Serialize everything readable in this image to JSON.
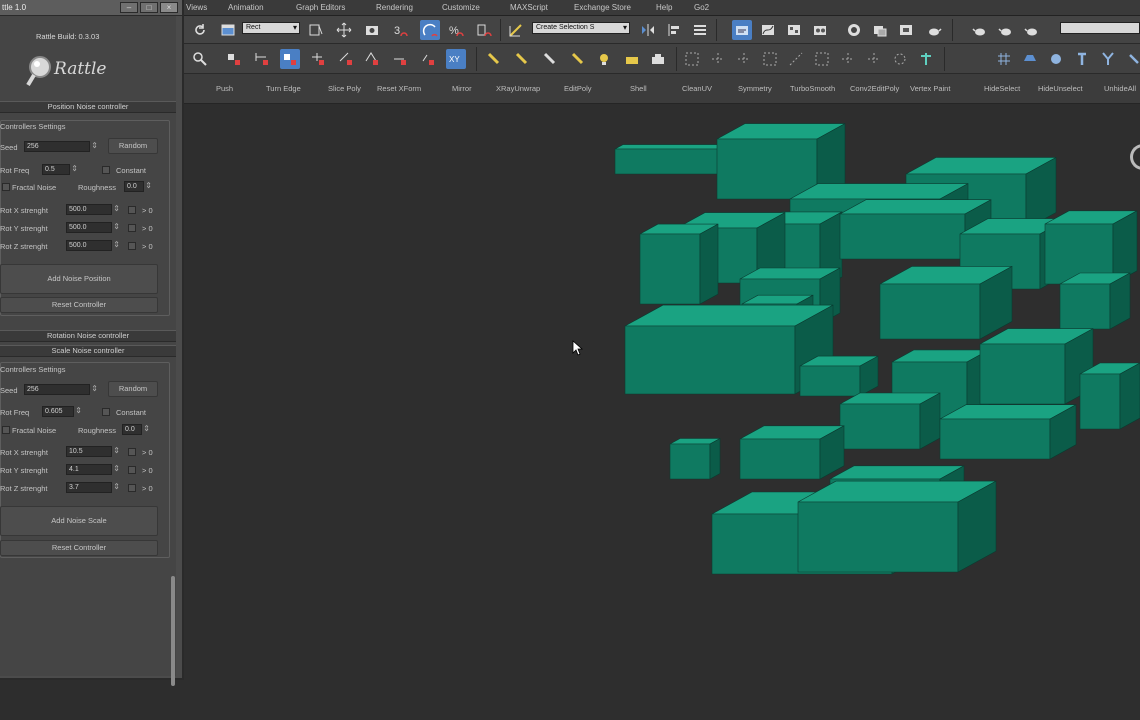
{
  "menubar": {
    "items": [
      "Views",
      "Animation",
      "Graph Editors",
      "Rendering",
      "Customize",
      "MAXScript",
      "Exchange Store",
      "Help",
      "Go2"
    ]
  },
  "toolbar": {
    "selection_filter": "Rect",
    "named_selection": "Create Selection S",
    "search_placeholder": ""
  },
  "command_row": {
    "buttons": [
      "Push",
      "Turn Edge",
      "Slice Poly",
      "Reset XForm",
      "Mirror",
      "XRayUnwrap",
      "EditPoly",
      "Shell",
      "CleanUV",
      "Symmetry",
      "TurboSmooth",
      "Conv2EditPoly",
      "Vertex Paint",
      "HideSelect",
      "HideUnselect",
      "UnhideAll"
    ]
  },
  "panel": {
    "window_title": "ttle 1.0",
    "build_label": "Rattle Build: 0.3.03",
    "logo_text": "Rattle",
    "position": {
      "header": "Position Noise controller",
      "group_title": "Controllers Settings",
      "seed_label": "Seed",
      "seed_value": "256",
      "random_label": "Random",
      "rot_freq_label": "Rot Freq",
      "rot_freq_value": "0.5",
      "constant_label": "Constant",
      "fractal_label": "Fractal Noise",
      "roughness_label": "Roughness",
      "roughness_value": "0.0",
      "x_label": "Rot X strenght",
      "x_value": "500.0",
      "y_label": "Rot Y strenght",
      "y_value": "500.0",
      "z_label": "Rot Z strenght",
      "z_value": "500.0",
      "gt0": "> 0",
      "add_button": "Add Noise Position",
      "reset_button": "Reset Controller"
    },
    "rotation_header": "Rotation Noise controller",
    "scale": {
      "header": "Scale Noise controller",
      "group_title": "Controllers Settings",
      "seed_label": "Seed",
      "seed_value": "256",
      "random_label": "Random",
      "rot_freq_label": "Rot Freq",
      "rot_freq_value": "0.605",
      "constant_label": "Constant",
      "fractal_label": "Fractal Noise",
      "roughness_label": "Roughness",
      "roughness_value": "0.0",
      "x_label": "Rot X strenght",
      "x_value": "10.5",
      "y_label": "Rot Y strenght",
      "y_value": "4.1",
      "z_label": "Rot Z strenght",
      "z_value": "3.7",
      "gt0": "> 0",
      "add_button": "Add Noise Scale",
      "reset_button": "Reset Controller"
    }
  },
  "colors": {
    "box_top": "#1aa382",
    "box_front": "#0f7a61",
    "box_side": "#0b5c49",
    "viewport_bg": "#2e2e2e",
    "active_tool": "#4a7fc4"
  }
}
